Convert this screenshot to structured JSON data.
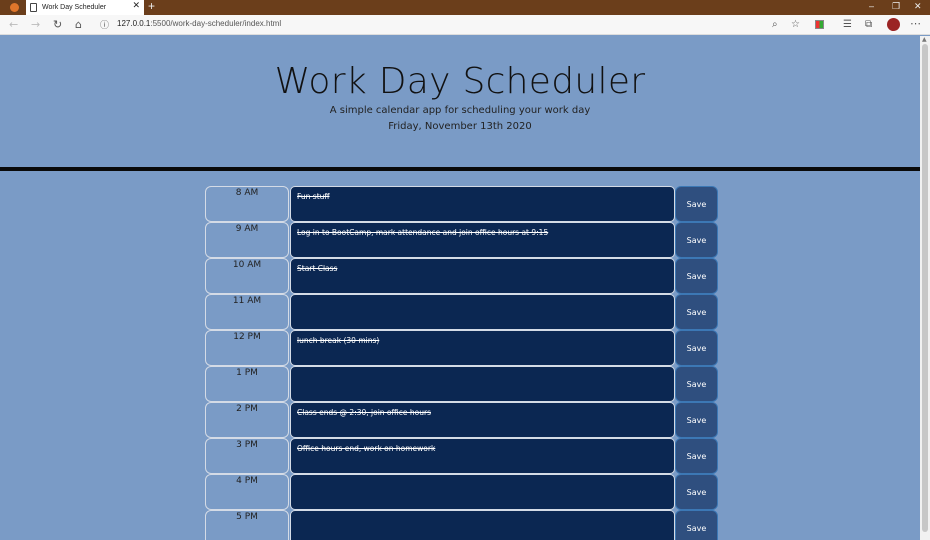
{
  "browser": {
    "tab_title": "Work Day Scheduler",
    "url_host": "127.0.0.1",
    "url_path": ":5500/work-day-scheduler/index.html"
  },
  "header": {
    "title": "Work Day Scheduler",
    "subtitle": "A simple calendar app for scheduling your work day",
    "date": "Friday, November 13th 2020"
  },
  "rows": [
    {
      "hour": "8 AM",
      "text": "Fun stuff",
      "save": "Save"
    },
    {
      "hour": "9 AM",
      "text": "Log in to BootCamp, mark attendance and join office hours at 9:15",
      "save": "Save"
    },
    {
      "hour": "10 AM",
      "text": "Start Class",
      "save": "Save"
    },
    {
      "hour": "11 AM",
      "text": "",
      "save": "Save"
    },
    {
      "hour": "12 PM",
      "text": "lunch break (30 mins)",
      "save": "Save"
    },
    {
      "hour": "1 PM",
      "text": "",
      "save": "Save"
    },
    {
      "hour": "2 PM",
      "text": "Class ends @ 2:30, join office hours",
      "save": "Save"
    },
    {
      "hour": "3 PM",
      "text": "Office hours end, work on homework",
      "save": "Save"
    },
    {
      "hour": "4 PM",
      "text": "",
      "save": "Save"
    },
    {
      "hour": "5 PM",
      "text": "",
      "save": "Save"
    }
  ],
  "colors": {
    "page_bg": "#7a9bc6",
    "textarea_bg": "#0b2752",
    "save_bg": "#2f4f7f"
  },
  "icons": [
    "back-icon",
    "forward-icon",
    "refresh-icon",
    "home-icon",
    "info-icon",
    "zoom-icon",
    "star-icon",
    "favorites-icon",
    "collections-icon",
    "more-icon"
  ]
}
